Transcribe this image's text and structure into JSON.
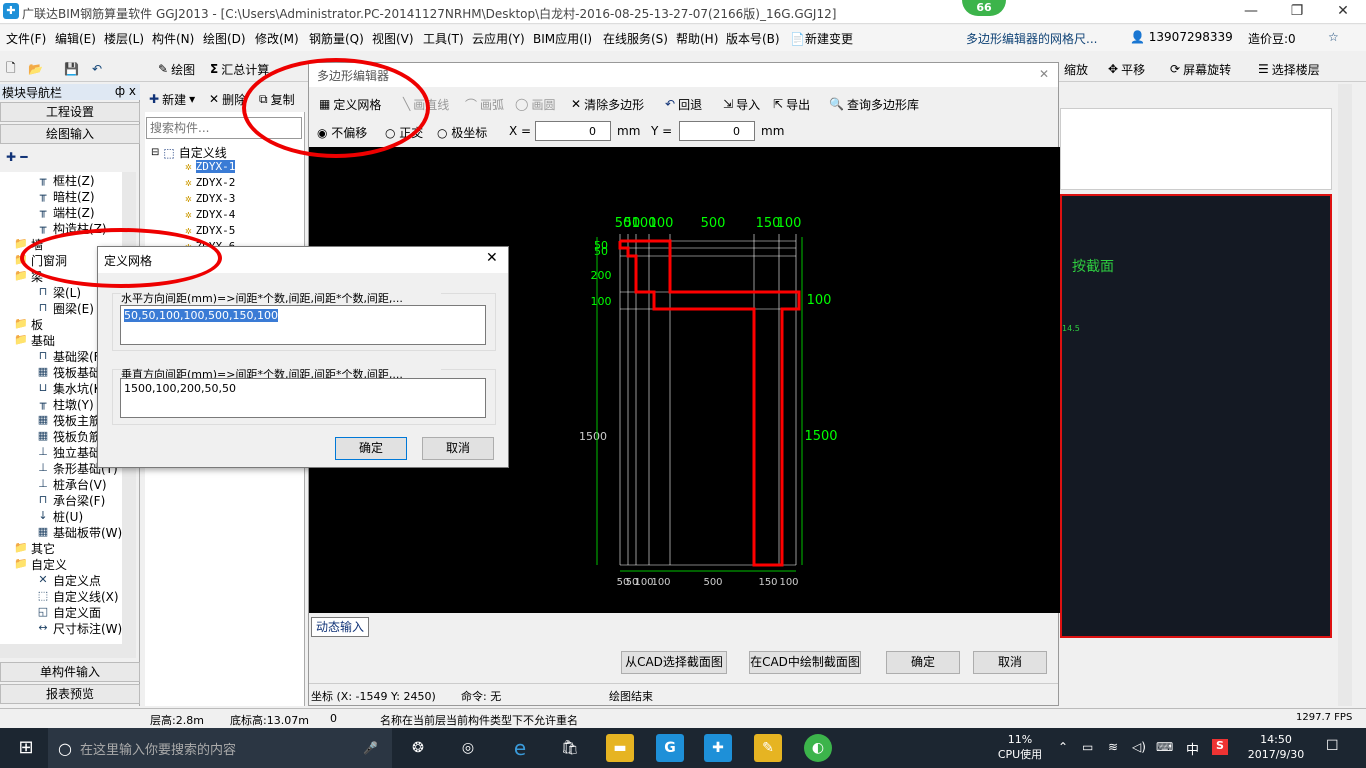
{
  "window": {
    "title": "广联达BIM钢筋算量软件 GGJ2013 - [C:\\Users\\Administrator.PC-20141127NRHM\\Desktop\\白龙村-2016-08-25-13-27-07(2166版)_16G.GGJ12]",
    "badge": "66",
    "minimize": "—",
    "maximize": "❐",
    "close": "✕"
  },
  "menu": {
    "items": [
      "文件(F)",
      "编辑(E)",
      "楼层(L)",
      "构件(N)",
      "绘图(D)",
      "修改(M)",
      "钢筋量(Q)",
      "视图(V)",
      "工具(T)",
      "云应用(Y)",
      "BIM应用(I)",
      "在线服务(S)",
      "帮助(H)",
      "版本号(B)"
    ],
    "new_change": "新建变更",
    "ime_labels": [
      "中",
      "°,"
    ],
    "notice_text": "多边形编辑器的网格尺...",
    "phone": "13907298339",
    "cost_label": "造价豆:0"
  },
  "toolbar": {
    "draw": "绘图",
    "sum": "汇总计算",
    "zoom": "缩放",
    "pan": "平移",
    "rotate": "屏幕旋转",
    "select_floor": "选择楼层"
  },
  "left_panel": {
    "title": "模块导航栏",
    "pin": "ф x",
    "tabs": [
      "工程设置",
      "绘图输入"
    ],
    "items": [
      {
        "label": "框柱(Z)",
        "icon": "column-icon"
      },
      {
        "label": "暗柱(Z)",
        "icon": "column-icon"
      },
      {
        "label": "端柱(Z)",
        "icon": "column-icon"
      },
      {
        "label": "构造柱(Z)",
        "icon": "column-icon"
      },
      {
        "label": "墙",
        "icon": "folder-icon"
      },
      {
        "label": "门窗洞",
        "icon": "folder-icon"
      },
      {
        "label": "梁",
        "icon": "folder-icon"
      },
      {
        "label": "梁(L)",
        "icon": "beam-icon"
      },
      {
        "label": "圈梁(E)",
        "icon": "beam-icon"
      },
      {
        "label": "板",
        "icon": "folder-icon"
      },
      {
        "label": "基础",
        "icon": "folder-icon"
      },
      {
        "label": "基础梁(F)",
        "icon": "beam-icon"
      },
      {
        "label": "筏板基础(M)",
        "icon": "slab-icon"
      },
      {
        "label": "集水坑(K)",
        "icon": "pit-icon"
      },
      {
        "label": "柱墩(Y)",
        "icon": "column-icon"
      },
      {
        "label": "筏板主筋(R)",
        "icon": "slab-icon"
      },
      {
        "label": "筏板负筋(X)",
        "icon": "slab-icon"
      },
      {
        "label": "独立基础(P)",
        "icon": "foundation-icon"
      },
      {
        "label": "条形基础(T)",
        "icon": "foundation-icon"
      },
      {
        "label": "桩承台(V)",
        "icon": "foundation-icon"
      },
      {
        "label": "承台梁(F)",
        "icon": "beam-icon"
      },
      {
        "label": "桩(U)",
        "icon": "pile-icon"
      },
      {
        "label": "基础板带(W)",
        "icon": "slab-icon"
      },
      {
        "label": "其它",
        "icon": "folder-icon"
      },
      {
        "label": "自定义",
        "icon": "folder-icon"
      },
      {
        "label": "自定义点",
        "icon": "point-icon"
      },
      {
        "label": "自定义线(X)",
        "icon": "line-icon"
      },
      {
        "label": "自定义面",
        "icon": "face-icon"
      },
      {
        "label": "尺寸标注(W)",
        "icon": "dimension-icon"
      }
    ],
    "bottom_tabs": [
      "单构件输入",
      "报表预览"
    ]
  },
  "component_list": {
    "new": "新建",
    "delete": "删除",
    "copy": "复制",
    "search_placeholder": "搜索构件...",
    "root": "自定义线",
    "items": [
      "ZDYX-1",
      "ZDYX-2",
      "ZDYX-3",
      "ZDYX-4",
      "ZDYX-5",
      "ZDYX-6"
    ]
  },
  "poly_editor": {
    "title": "多边形编辑器",
    "toolbar": {
      "define_grid": "定义网格",
      "line": "画直线",
      "arc": "画弧",
      "circle": "画圆",
      "clear": "清除多边形",
      "undo": "回退",
      "import": "导入",
      "export": "导出",
      "query": "查询多边形库"
    },
    "offset": {
      "none": "不偏移",
      "ortho": "正交",
      "polar": "极坐标",
      "x_label": "X =",
      "x_value": "0",
      "y_label": "Y =",
      "y_value": "0",
      "unit": "mm"
    },
    "dynamic_input": "动态输入",
    "buttons": {
      "from_cad": "从CAD选择截面图",
      "draw_in_cad": "在CAD中绘制截面图",
      "ok": "确定",
      "cancel": "取消"
    },
    "status": {
      "coord": "坐标 (X: -1549 Y: 2450)",
      "command": "命令: 无",
      "end": "绘图结束"
    }
  },
  "canvas": {
    "top_dims": [
      "50",
      "50",
      "100",
      "100",
      "500",
      "150",
      "100"
    ],
    "bottom_dims": [
      "50",
      "50",
      "100",
      "100",
      "500",
      "150",
      "100"
    ],
    "left_dims": [
      "50",
      "50",
      "200",
      "100",
      "1500"
    ],
    "right_dims": [
      "100",
      "1500"
    ],
    "colors": {
      "grid": "#ffffff",
      "outline": "#ff0000",
      "dim": "#00ff00",
      "ext": "#00c000"
    }
  },
  "grid_dialog": {
    "title": "定义网格",
    "h_label": "水平方向间距(mm)=>间距*个数,间距,间距*个数,间距,...",
    "h_value": "50,50,100,100,500,150,100",
    "v_label": "垂直方向间距(mm)=>间距*个数,间距,间距*个数,间距,...",
    "v_value": "1500,100,200,50,50",
    "ok": "确定",
    "cancel": "取消"
  },
  "right_panel": {
    "text": "按截面",
    "small": "14.5"
  },
  "statusbar": {
    "floor_height": "层高:2.8m",
    "base_height": "底标高:13.07m",
    "zero": "0",
    "message": "名称在当前层当前构件类型下不允许重名",
    "fps": "1297.7 FPS"
  },
  "taskbar": {
    "search_placeholder": "在这里输入你要搜索的内容",
    "cpu_percent": "11%",
    "cpu_label": "CPU使用",
    "ime": "中",
    "time": "14:50",
    "date": "2017/9/30"
  }
}
